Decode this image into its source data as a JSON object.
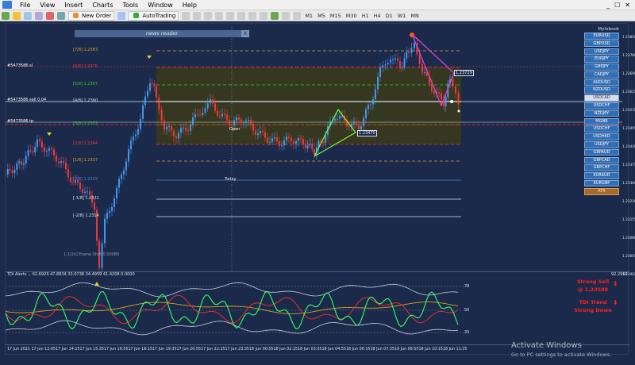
{
  "menu": {
    "items": [
      "File",
      "View",
      "Insert",
      "Charts",
      "Tools",
      "Window",
      "Help"
    ],
    "window_controls": [
      "_",
      "☐",
      "✕"
    ]
  },
  "toolbar": {
    "new_order": "New Order",
    "autotrading": "AutoTrading",
    "timeframes": [
      "M1",
      "M5",
      "M15",
      "M30",
      "H1",
      "H4",
      "D1",
      "W1",
      "MN"
    ]
  },
  "news_reader": {
    "title": "news reader",
    "close": "X"
  },
  "symbol_panel": {
    "account": "Myfxbook",
    "symbols": [
      "EURUSD",
      "GBPUSD",
      "USDJPY",
      "EURJPY",
      "GBPJPY",
      "CADJPY",
      "AUDUSD",
      "NZDUSD",
      "USDCAD",
      "USDCHF",
      "NZDJPY",
      "MGNR",
      "USDCHF",
      "USDHKD",
      "USDJPY",
      "GBPAUD",
      "GBPCAD",
      "GBPCHF",
      "EURAUD",
      "EURGBP"
    ],
    "selected_index": 8,
    "extra_button": "ATR"
  },
  "murrey_levels": [
    {
      "label": "[7/8]",
      "price": "1.2383",
      "color": "#e0a030"
    },
    {
      "label": "[6/8]",
      "price": "1.2375",
      "color": "#ff3333"
    },
    {
      "label": "[5/8]",
      "price": "1.2367",
      "color": "#33cc33"
    },
    {
      "label": "[4/8]",
      "price": "1.2360",
      "color": "#dbe3f0"
    },
    {
      "label": "[3/8]",
      "price": "1.2352",
      "color": "#33cc33"
    },
    {
      "label": "[2/8]",
      "price": "1.2344",
      "color": "#ff3333"
    },
    {
      "label": "[1/8]",
      "price": "1.2337",
      "color": "#e0a030"
    },
    {
      "label": "[0/8]",
      "price": "1.2329",
      "color": "#4a7fd8"
    },
    {
      "label": "[-1/8]",
      "price": "1.2321",
      "color": "#dbe3f0"
    },
    {
      "label": "[-2/8]",
      "price": "1.2314",
      "color": "#dbe3f0"
    }
  ],
  "chart_labels": {
    "left_top": "#5473586 sl",
    "left_mid": "#5473586 sell 0.04",
    "left_low": "#5473586 tp",
    "open": "Open",
    "today": "Today",
    "frame_note": "[-1/2o] Frame Shift 0.00080",
    "pattern_price_1": "1.23729",
    "pattern_price_2": "1.23470"
  },
  "price_axis": [
    "1.23850",
    "1.23780",
    "1.23690",
    "1.23625",
    "1.23535",
    "1.23495",
    "1.23430",
    "1.23375",
    "1.23300",
    "1.23230",
    "1.23155",
    "1.23080",
    "1.23005",
    "1.22992"
  ],
  "indicator": {
    "label": "TDI Alerts ⌄ 62.6929 47.8834 33.0738 34.4959 41.4208 0.0000",
    "levels": [
      "78",
      "50",
      "33"
    ],
    "signal_1": "Strong Sell",
    "signal_1_price": "@ 1.23588",
    "signal_2": "TDI Trend",
    "signal_2b": "Strong Down",
    "top_value": "92.2992"
  },
  "time_axis": [
    "17 Jun 2021",
    "17 Jun 12:05",
    "17 Jun 14:15",
    "17 Jun 15:35",
    "17 Jun 16:55",
    "17 Jun 18:15",
    "17 Jun 19:35",
    "17 Jun 20:55",
    "17 Jun 22:15",
    "17 Jun 23:35",
    "18 Jun 00:55",
    "18 Jun 02:15",
    "18 Jun 03:35",
    "18 Jun 04:55",
    "18 Jun 06:15",
    "18 Jun 07:35",
    "18 Jun 08:55",
    "18 Jun 10:15",
    "18 Jun 11:35"
  ],
  "watermark": {
    "line1": "Activate Windows",
    "line2": "Go to PC settings to activate Windows."
  },
  "colors": {
    "background": "#1b2a4a",
    "bull": "#00ff55",
    "bear": "#ff3333",
    "zone": "#3a3a1a"
  }
}
